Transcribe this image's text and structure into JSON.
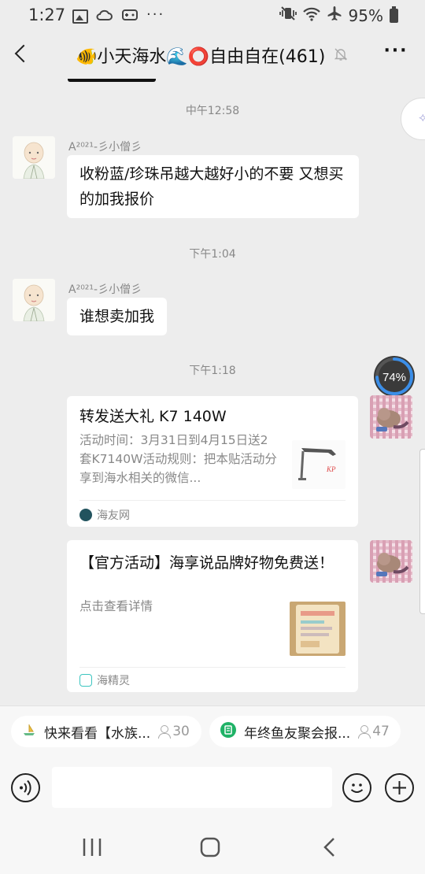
{
  "status_bar": {
    "time": "1:27",
    "battery": "95%",
    "icons": [
      "image-icon",
      "cloud-icon",
      "game-icon",
      "more-dots-icon",
      "vibrate-icon",
      "wifi-icon",
      "airplane-icon",
      "battery-icon"
    ]
  },
  "header": {
    "title": "🐠小天海水🌊⭕自由自在(461)",
    "muted": true
  },
  "messages": [
    {
      "type": "time",
      "text": "中午12:58"
    },
    {
      "type": "text",
      "sender": "A²⁰²¹-彡小僧彡",
      "text": "收粉蓝/珍珠吊越大越好小的不要 又想买的加我报价"
    },
    {
      "type": "time",
      "text": "下午1:04"
    },
    {
      "type": "text",
      "sender": "A²⁰²¹-彡小僧彡",
      "text": "谁想卖加我"
    },
    {
      "type": "time",
      "text": "下午1:18"
    },
    {
      "type": "card",
      "title": "转发送大礼 K7 140W",
      "desc": "活动时间：3月31日到4月15日送2套K7140W活动规则：把本贴活动分享到海水相关的微信...",
      "source": "海友网"
    },
    {
      "type": "card",
      "title": "【官方活动】海享说品牌好物免费送！",
      "desc": "点击查看详情",
      "source": "海精灵"
    }
  ],
  "progress": {
    "label": "74%",
    "value": 0.74
  },
  "shortcuts": [
    {
      "label": "快来看看【水族...",
      "count": "30"
    },
    {
      "label": "年终鱼友聚会报...",
      "count": "47"
    }
  ],
  "input": {
    "placeholder": ""
  },
  "colors": {
    "background": "#ededed",
    "bubble": "#ffffff",
    "progress_ring": "#3b8ee8",
    "shortcut_icon_green": "#1fb266"
  }
}
